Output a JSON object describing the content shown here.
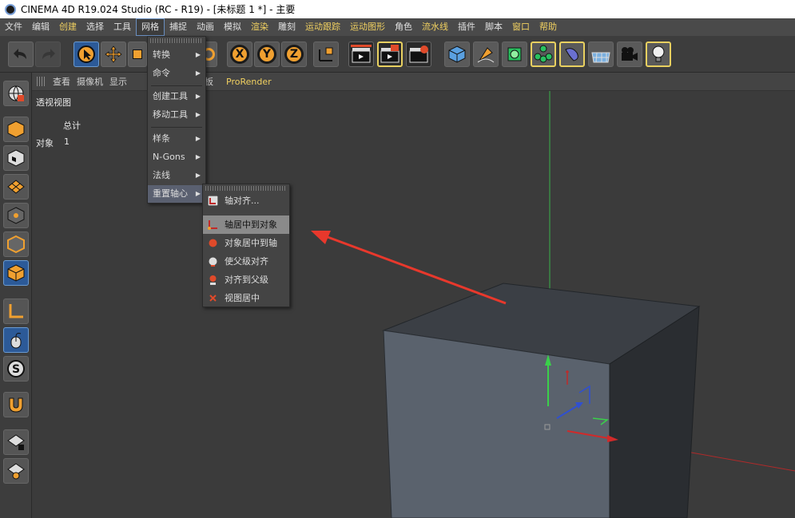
{
  "window": {
    "title": "CINEMA 4D R19.024 Studio (RC - R19) - [未标题 1 *] - 主要"
  },
  "menubar": {
    "items": [
      {
        "label": "文件",
        "hl": false
      },
      {
        "label": "编辑",
        "hl": false
      },
      {
        "label": "创建",
        "hl": true
      },
      {
        "label": "选择",
        "hl": false
      },
      {
        "label": "工具",
        "hl": false
      },
      {
        "label": "网格",
        "hl": false,
        "active": true
      },
      {
        "label": "捕捉",
        "hl": false
      },
      {
        "label": "动画",
        "hl": false
      },
      {
        "label": "模拟",
        "hl": false
      },
      {
        "label": "渲染",
        "hl": true
      },
      {
        "label": "雕刻",
        "hl": false
      },
      {
        "label": "运动跟踪",
        "hl": true
      },
      {
        "label": "运动图形",
        "hl": true
      },
      {
        "label": "角色",
        "hl": false
      },
      {
        "label": "流水线",
        "hl": true
      },
      {
        "label": "插件",
        "hl": false
      },
      {
        "label": "脚本",
        "hl": false
      },
      {
        "label": "窗口",
        "hl": true
      },
      {
        "label": "帮助",
        "hl": true
      }
    ]
  },
  "toolbar": {
    "undo_icon": "undo-icon",
    "axis_x": "X",
    "axis_y": "Y",
    "axis_z": "Z"
  },
  "viewport_header": {
    "items": [
      "查看",
      "摄像机",
      "显示"
    ],
    "panel_partial": "面板",
    "prorender": "ProRender"
  },
  "viewport": {
    "name": "透视视图",
    "stats_title": "总计",
    "stats_row_label": "对象",
    "stats_row_value": "1"
  },
  "mesh_menu": {
    "items": [
      "转换",
      "命令",
      "创建工具",
      "移动工具",
      "样条",
      "N-Gons",
      "法线",
      "重置轴心"
    ]
  },
  "reset_axis_submenu": {
    "items": [
      "轴对齐...",
      "轴居中到对象",
      "对象居中到轴",
      "使父级对齐",
      "对齐到父级",
      "视图居中"
    ]
  },
  "colors": {
    "accent_yellow": "#f0d060",
    "selection_blue": "#2c5a98",
    "arrow_red": "#e8382c"
  }
}
